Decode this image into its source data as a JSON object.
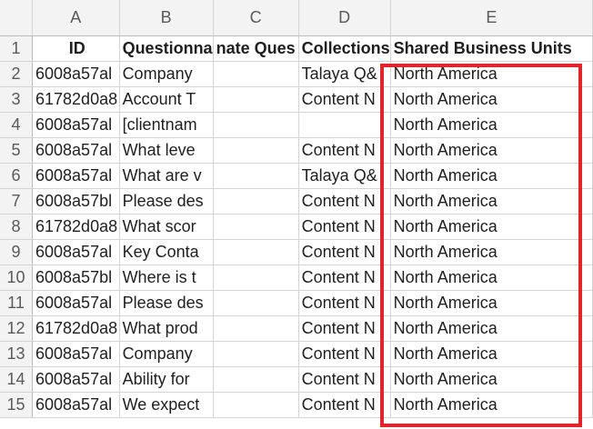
{
  "columns": [
    "A",
    "B",
    "C",
    "D",
    "E"
  ],
  "header_row": {
    "row_number": "1",
    "cells": [
      "ID",
      "Questionna",
      "nate Ques",
      "Collections",
      "Shared Business Units"
    ]
  },
  "rows": [
    {
      "n": "2",
      "a": "6008a57al",
      "b": "Company",
      "c": "",
      "d": "Talaya Q&",
      "e": "North America"
    },
    {
      "n": "3",
      "a": "61782d0a8",
      "b": "Account T",
      "c": "",
      "d": "Content N",
      "e": "North America"
    },
    {
      "n": "4",
      "a": "6008a57al",
      "b": "[clientnam",
      "c": "",
      "d": "",
      "e": "North America"
    },
    {
      "n": "5",
      "a": "6008a57al",
      "b": "What leve",
      "c": "",
      "d": "Content N",
      "e": "North America"
    },
    {
      "n": "6",
      "a": "6008a57al",
      "b": "What are v",
      "c": "",
      "d": "Talaya Q&",
      "e": "North America"
    },
    {
      "n": "7",
      "a": "6008a57bl",
      "b": "Please des",
      "c": "",
      "d": "Content N",
      "e": "North America"
    },
    {
      "n": "8",
      "a": "61782d0a8",
      "b": "What scor",
      "c": "",
      "d": "Content N",
      "e": "North America"
    },
    {
      "n": "9",
      "a": "6008a57al",
      "b": "Key Conta",
      "c": "",
      "d": "Content N",
      "e": "North America"
    },
    {
      "n": "10",
      "a": "6008a57bl",
      "b": "Where is t",
      "c": "",
      "d": "Content N",
      "e": "North America"
    },
    {
      "n": "11",
      "a": "6008a57al",
      "b": "Please des",
      "c": "",
      "d": "Content N",
      "e": "North America"
    },
    {
      "n": "12",
      "a": "61782d0a8",
      "b": "What prod",
      "c": "",
      "d": "Content N",
      "e": "North America"
    },
    {
      "n": "13",
      "a": "6008a57al",
      "b": "Company",
      "c": "",
      "d": "Content N",
      "e": "North America"
    },
    {
      "n": "14",
      "a": "6008a57al",
      "b": "Ability for",
      "c": "",
      "d": "Content N",
      "e": "North America"
    },
    {
      "n": "15",
      "a": "6008a57al",
      "b": "We expect",
      "c": "",
      "d": "Content N",
      "e": "North America"
    }
  ],
  "highlight_color": "#e0262b"
}
